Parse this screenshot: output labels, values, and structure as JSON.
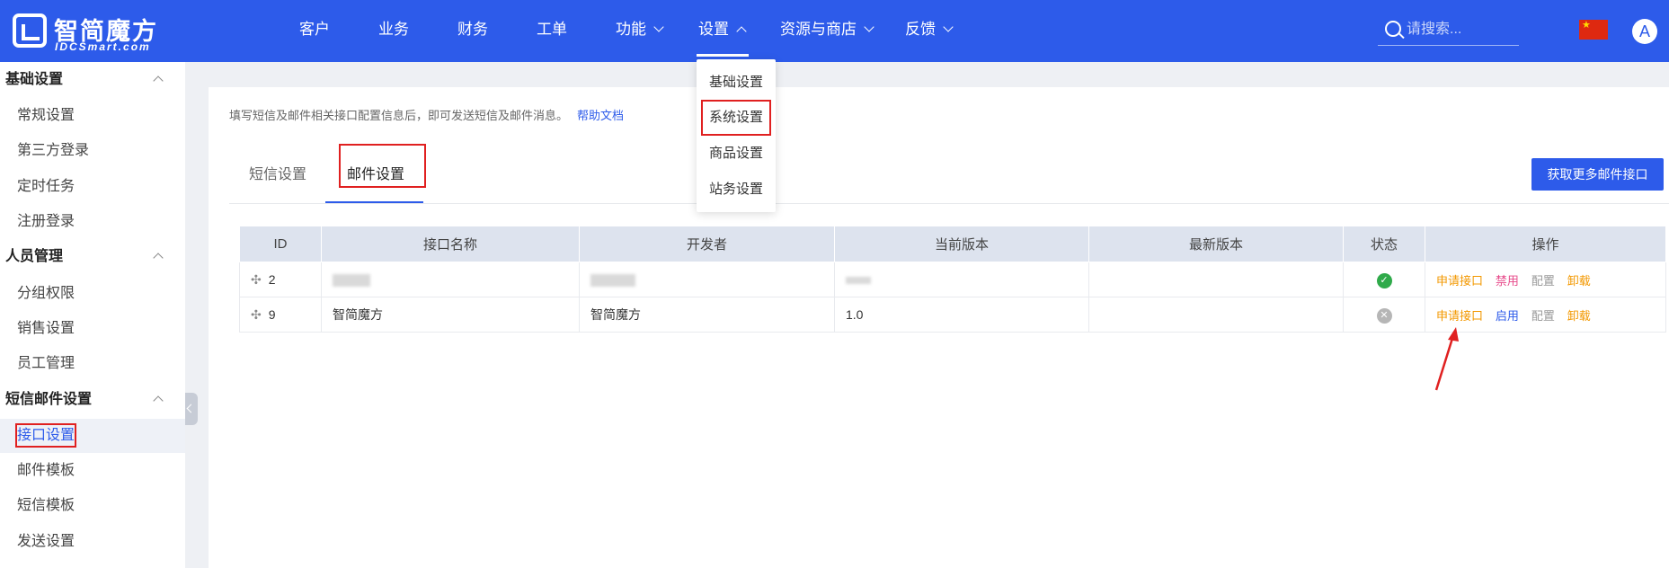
{
  "brand": {
    "name": "智简魔方",
    "sub": "IDCSmart.com"
  },
  "nav": {
    "items": [
      {
        "label": "客户"
      },
      {
        "label": "业务"
      },
      {
        "label": "财务"
      },
      {
        "label": "工单"
      },
      {
        "label": "功能"
      },
      {
        "label": "设置"
      },
      {
        "label": "资源与商店"
      },
      {
        "label": "反馈"
      }
    ],
    "active": "设置"
  },
  "search": {
    "placeholder": "请搜索..."
  },
  "avatar": {
    "initial": "A"
  },
  "settings_dropdown": {
    "items": [
      "基础设置",
      "系统设置",
      "商品设置",
      "站务设置"
    ],
    "highlighted": "系统设置"
  },
  "sidebar": {
    "groups": [
      {
        "label": "基础设置",
        "items": [
          "常规设置",
          "第三方登录",
          "定时任务",
          "注册登录"
        ]
      },
      {
        "label": "人员管理",
        "items": [
          "分组权限",
          "销售设置",
          "员工管理"
        ]
      },
      {
        "label": "短信邮件设置",
        "items": [
          "接口设置",
          "邮件模板",
          "短信模板",
          "发送设置"
        ]
      }
    ],
    "active_item": "接口设置"
  },
  "main": {
    "hint": "填写短信及邮件相关接口配置信息后，即可发送短信及邮件消息。",
    "help_link": "帮助文档",
    "tabs": [
      "短信设置",
      "邮件设置"
    ],
    "active_tab": "邮件设置",
    "more_button": "获取更多邮件接口"
  },
  "table": {
    "columns": [
      "ID",
      "接口名称",
      "开发者",
      "当前版本",
      "最新版本",
      "状态",
      "操作"
    ],
    "rows": [
      {
        "id": "2",
        "name": "",
        "developer": "",
        "version": "",
        "latest": "",
        "status": "enabled",
        "actions": [
          "申请接口",
          "禁用",
          "配置",
          "卸载"
        ]
      },
      {
        "id": "9",
        "name": "智简魔方",
        "developer": "智简魔方",
        "version": "1.0",
        "latest": "",
        "status": "disabled",
        "actions": [
          "申请接口",
          "启用",
          "配置",
          "卸载"
        ]
      }
    ]
  },
  "colors": {
    "primary": "#2d5bea",
    "highlight_box": "#e02020",
    "action_orange": "#f39800",
    "action_pink": "#e74a8a"
  }
}
